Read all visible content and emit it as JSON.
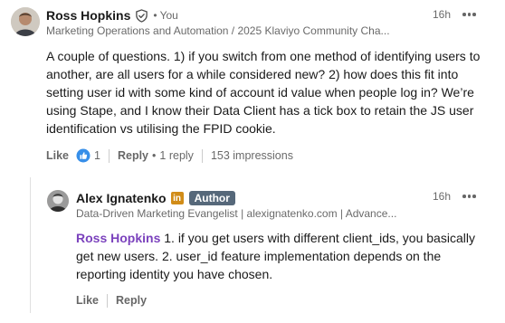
{
  "comment": {
    "author": "Ross Hopkins",
    "you_label": "You",
    "separator": "•",
    "headline": "Marketing Operations and Automation / 2025 Klaviyo Community Cha...",
    "time": "16h",
    "body": "A couple of questions. 1) if you switch from one method of identifying users to another, are all users for a while considered new? 2) how does this fit into setting user id with some kind of account id value when people log in? We’re using Stape, and I know their Data Client has a tick box to retain the JS user identification vs utilising the FPID cookie.",
    "actions": {
      "like_label": "Like",
      "reaction_count": "1",
      "reply_label": "Reply",
      "reply_count": "1 reply",
      "impressions": "153 impressions"
    }
  },
  "reply": {
    "author": "Alex Ignatenko",
    "linkedin_badge": "in",
    "author_badge": "Author",
    "headline": "Data-Driven Marketing Evangelist | alexignatenko.com | Advance...",
    "time": "16h",
    "mention": "Ross Hopkins",
    "body": " 1. if you get users with different client_ids, you basically get new users. 2. user_id feature implementation depends on the reporting identity you have chosen.",
    "actions": {
      "like_label": "Like",
      "reply_label": "Reply"
    }
  },
  "colors": {
    "mention": "#7b42bd",
    "author_badge_bg": "#56687a",
    "reaction_blue": "#378fe9",
    "linkedin_gold": "#d18c18"
  }
}
